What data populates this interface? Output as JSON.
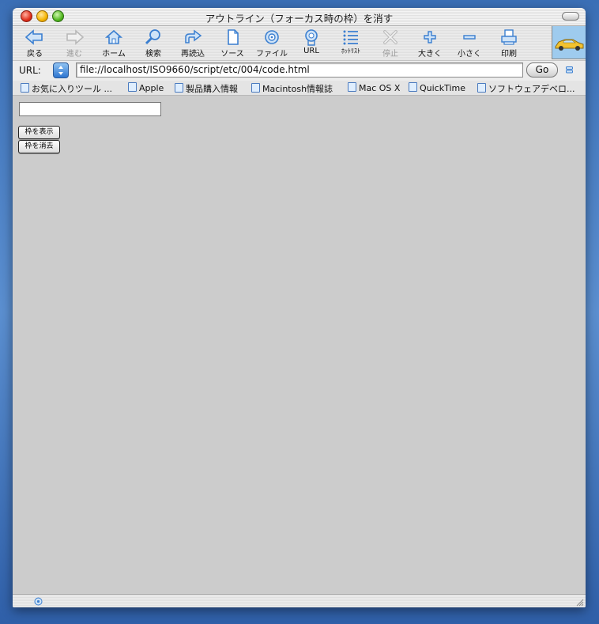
{
  "window": {
    "title": "アウトライン（フォーカス時の枠）を消す"
  },
  "toolbar": {
    "items": [
      {
        "label": "戻る",
        "icon": "back-arrow-icon",
        "enabled": true
      },
      {
        "label": "進む",
        "icon": "forward-arrow-icon",
        "enabled": false
      },
      {
        "label": "ホーム",
        "icon": "home-icon",
        "enabled": true
      },
      {
        "label": "検索",
        "icon": "search-icon",
        "enabled": true
      },
      {
        "label": "再読込",
        "icon": "reload-icon",
        "enabled": true
      },
      {
        "label": "ソース",
        "icon": "document-icon",
        "enabled": true
      },
      {
        "label": "ファイル",
        "icon": "file-target-icon",
        "enabled": true
      },
      {
        "label": "URL",
        "icon": "url-icon",
        "enabled": true
      },
      {
        "label": "ﾎｯﾄﾘｽﾄ",
        "icon": "hotlist-icon",
        "enabled": true
      },
      {
        "label": "停止",
        "icon": "stop-icon",
        "enabled": false
      },
      {
        "label": "大きく",
        "icon": "plus-icon",
        "enabled": true
      },
      {
        "label": "小さく",
        "icon": "minus-icon",
        "enabled": true
      },
      {
        "label": "印刷",
        "icon": "print-icon",
        "enabled": true
      }
    ]
  },
  "address": {
    "label": "URL:",
    "value": "file://localhost/ISO9660/script/etc/004/code.html",
    "go_label": "Go"
  },
  "favorites": [
    "お気に入りツール ...",
    "Apple",
    "製品購入情報",
    "Macintosh情報誌",
    "Mac OS X",
    "QuickTime",
    "ソフトウェアデベロ..."
  ],
  "page": {
    "input_value": "",
    "show_outline_button": "枠を表示",
    "hide_outline_button": "枠を消去"
  },
  "colors": {
    "accent": "#4a90d9",
    "content_background": "#cccccc",
    "logo_background": "#9ecbee"
  }
}
